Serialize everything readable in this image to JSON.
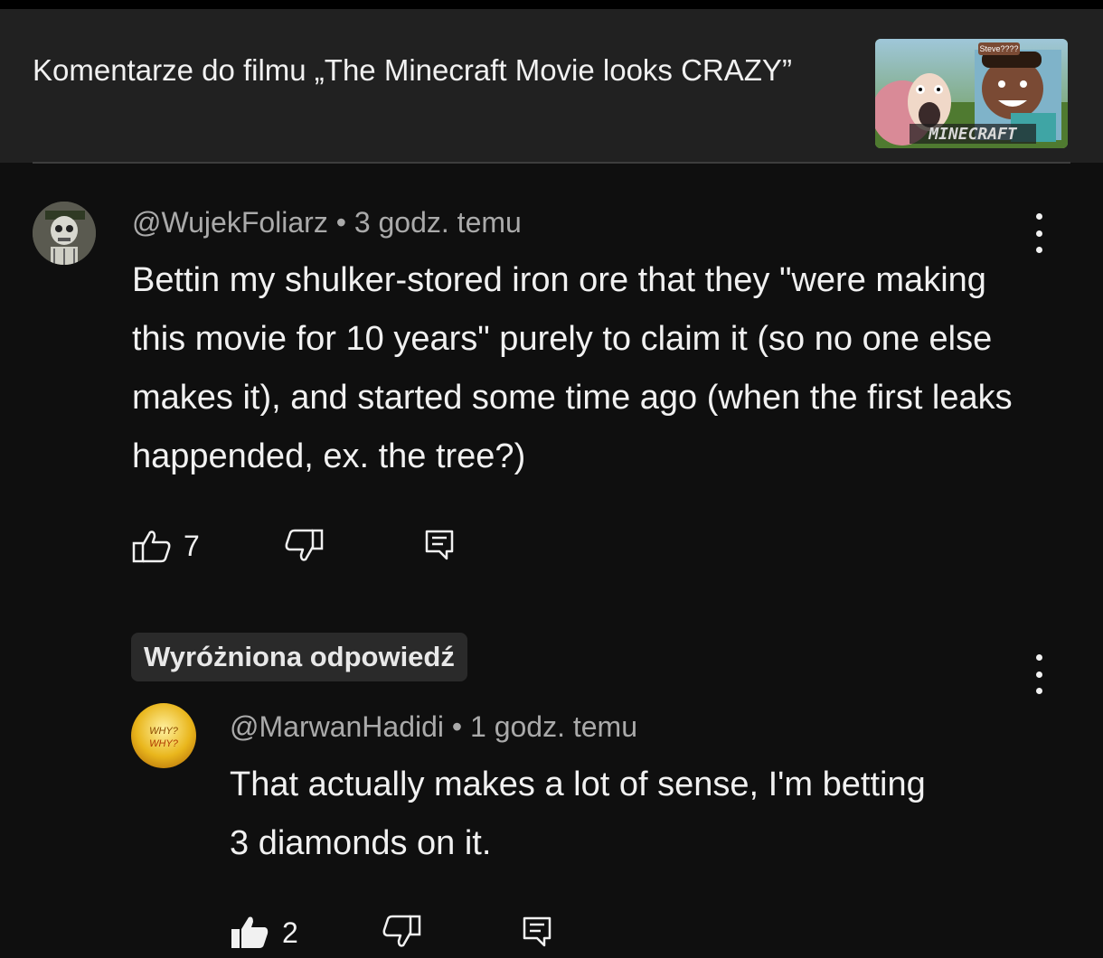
{
  "header": {
    "title": "Komentarze do filmu „The Minecraft Movie looks CRAZY”",
    "thumbnail": {
      "label_small": "Steve????",
      "label_logo": "MINECRAFT"
    }
  },
  "comment": {
    "author": "@WujekFoliarz",
    "time": "3 godz. temu",
    "text": "Bettin my shulker-stored iron ore that they \"were making this movie for 10 years\" purely to claim it (so no one else makes it), and started some time ago (when the first leaks happended, ex. the tree?)",
    "likes": "7"
  },
  "reply": {
    "badge": "Wyróżniona odpowiedź",
    "avatar_text": "WHY? WHY?",
    "author": "@MarwanHadidi",
    "time": "1 godz. temu",
    "text": "That actually makes a lot of sense, I'm betting 3 diamonds on it.",
    "likes": "2"
  },
  "colors": {
    "background": "#0f0f0f",
    "header_bg": "#212121",
    "text_primary": "#f1f1f1",
    "text_secondary": "#aaaaaa"
  }
}
